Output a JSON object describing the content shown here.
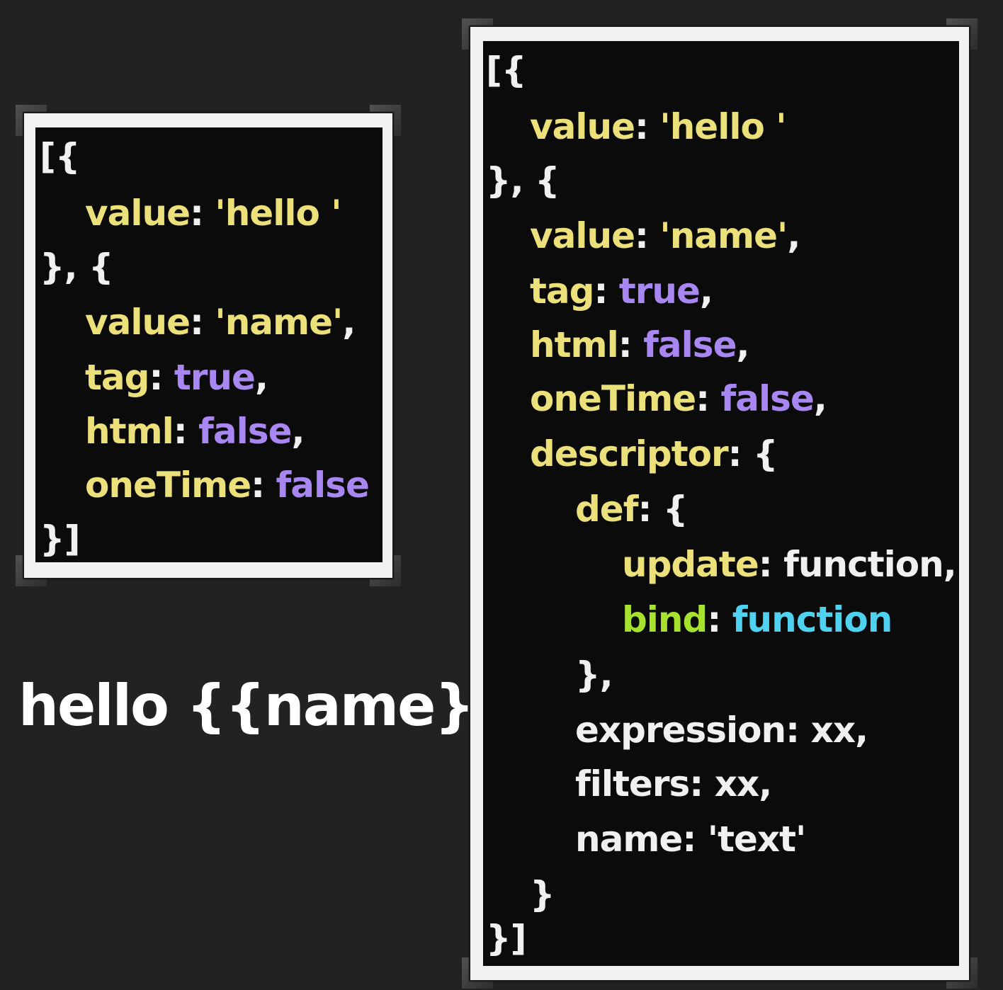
{
  "caption": "hello {{name}}",
  "small_snippet": {
    "lines": [
      {
        "open": "[{"
      },
      {
        "key": "value",
        "colon": ":",
        "str": "'hello '"
      },
      {
        "close": "}, {"
      },
      {
        "key": "value",
        "colon": ":",
        "str": "'name'",
        "comma": ","
      },
      {
        "key": "tag",
        "colon": ":",
        "bool": "true",
        "comma": ","
      },
      {
        "key": "html",
        "colon": ":",
        "bool": "false",
        "comma": ","
      },
      {
        "key": "oneTime",
        "colon": ":",
        "bool": "false"
      },
      {
        "close": "}]"
      }
    ]
  },
  "large_snippet": {
    "lines": [
      {
        "open": "[{"
      },
      {
        "key": "value",
        "colon": ":",
        "str": "'hello '"
      },
      {
        "close": "}, {"
      },
      {
        "key": "value",
        "colon": ":",
        "str": "'name'",
        "comma": ","
      },
      {
        "key": "tag",
        "colon": ":",
        "bool": "true",
        "comma": ","
      },
      {
        "key": "html",
        "colon": ":",
        "bool": "false",
        "comma": ","
      },
      {
        "key": "oneTime",
        "colon": ":",
        "bool": "false",
        "comma": ","
      },
      {
        "key": "descriptor",
        "colon": ":",
        "brace": "{"
      },
      {
        "key": "def",
        "colon": ":",
        "brace": "{"
      },
      {
        "key": "update",
        "colon": ":",
        "val": "function",
        "comma": ","
      },
      {
        "key": "bind",
        "colon": ":",
        "val": "function"
      },
      {
        "close": "},"
      },
      {
        "key": "expression",
        "colon": ":",
        "val": "xx",
        "comma": ","
      },
      {
        "key": "filters",
        "colon": ":",
        "val": "xx",
        "comma": ","
      },
      {
        "key": "name",
        "colon": ":",
        "str": "'text'"
      },
      {
        "close": "}"
      },
      {
        "close": "}]"
      }
    ]
  }
}
